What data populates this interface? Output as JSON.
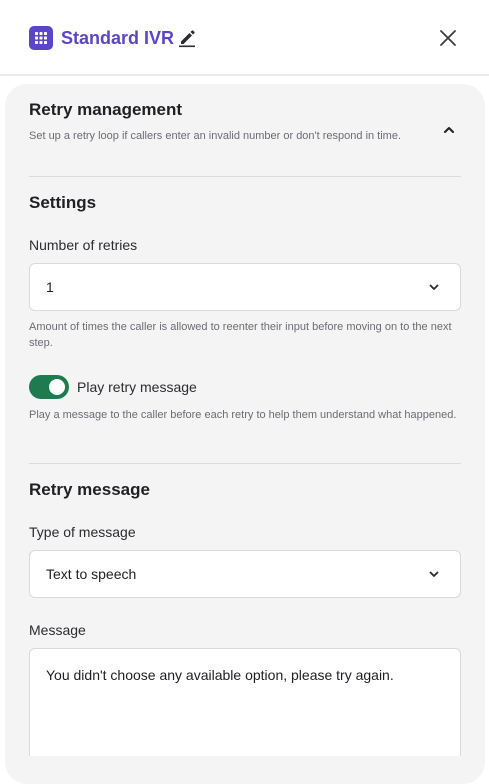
{
  "header": {
    "title": "Standard IVR",
    "icons": {
      "app": "grid-icon",
      "edit": "pencil-icon",
      "close": "close-icon"
    }
  },
  "retry_management": {
    "heading": "Retry management",
    "description": "Set up a retry loop if callers enter an invalid number or don't respond in time.",
    "collapse_icon": "chevron-up-icon"
  },
  "settings": {
    "heading": "Settings",
    "retries_label": "Number of retries",
    "retries_value": "1",
    "retries_help": "Amount of times the caller is allowed to reenter their input before moving on to the next step.",
    "play_retry_label": "Play retry message",
    "play_retry_enabled": true,
    "play_retry_help": "Play a message to the caller before each retry to help them understand what happened."
  },
  "retry_message": {
    "heading": "Retry message",
    "type_label": "Type of message",
    "type_value": "Text to speech",
    "message_label": "Message",
    "message_value": "You didn't choose any available option, please try again."
  },
  "colors": {
    "brand": "#5b46c7",
    "toggle_on": "#1e7b4f",
    "panel_bg": "#f4f4f5"
  }
}
